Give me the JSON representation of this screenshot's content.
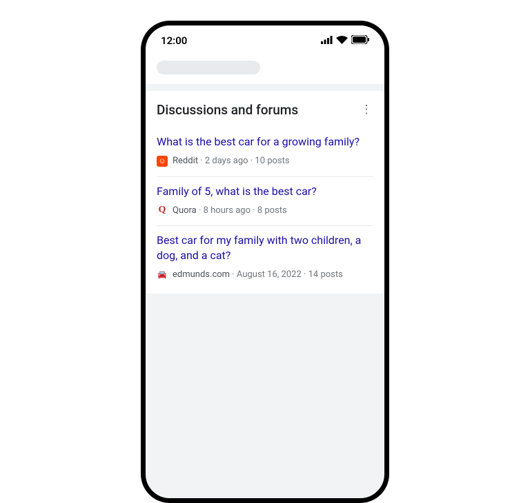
{
  "status": {
    "time": "12:00"
  },
  "card": {
    "title": "Discussions and forums"
  },
  "items": [
    {
      "title": "What is the best car for a growing family?",
      "source": "Reddit",
      "meta": " · 2 days ago · 10 posts",
      "favicon_class": "reddit",
      "favicon_glyph": "☺"
    },
    {
      "title": "Family of 5, what is the best car?",
      "source": "Quora",
      "meta": " · 8 hours ago · 8 posts",
      "favicon_class": "quora",
      "favicon_glyph": "Q"
    },
    {
      "title": "Best car for my family with two children, a dog, and a cat?",
      "source": "edmunds.com",
      "meta": " · August 16, 2022 · 14 posts",
      "favicon_class": "edmunds",
      "favicon_glyph": "🚘"
    }
  ]
}
